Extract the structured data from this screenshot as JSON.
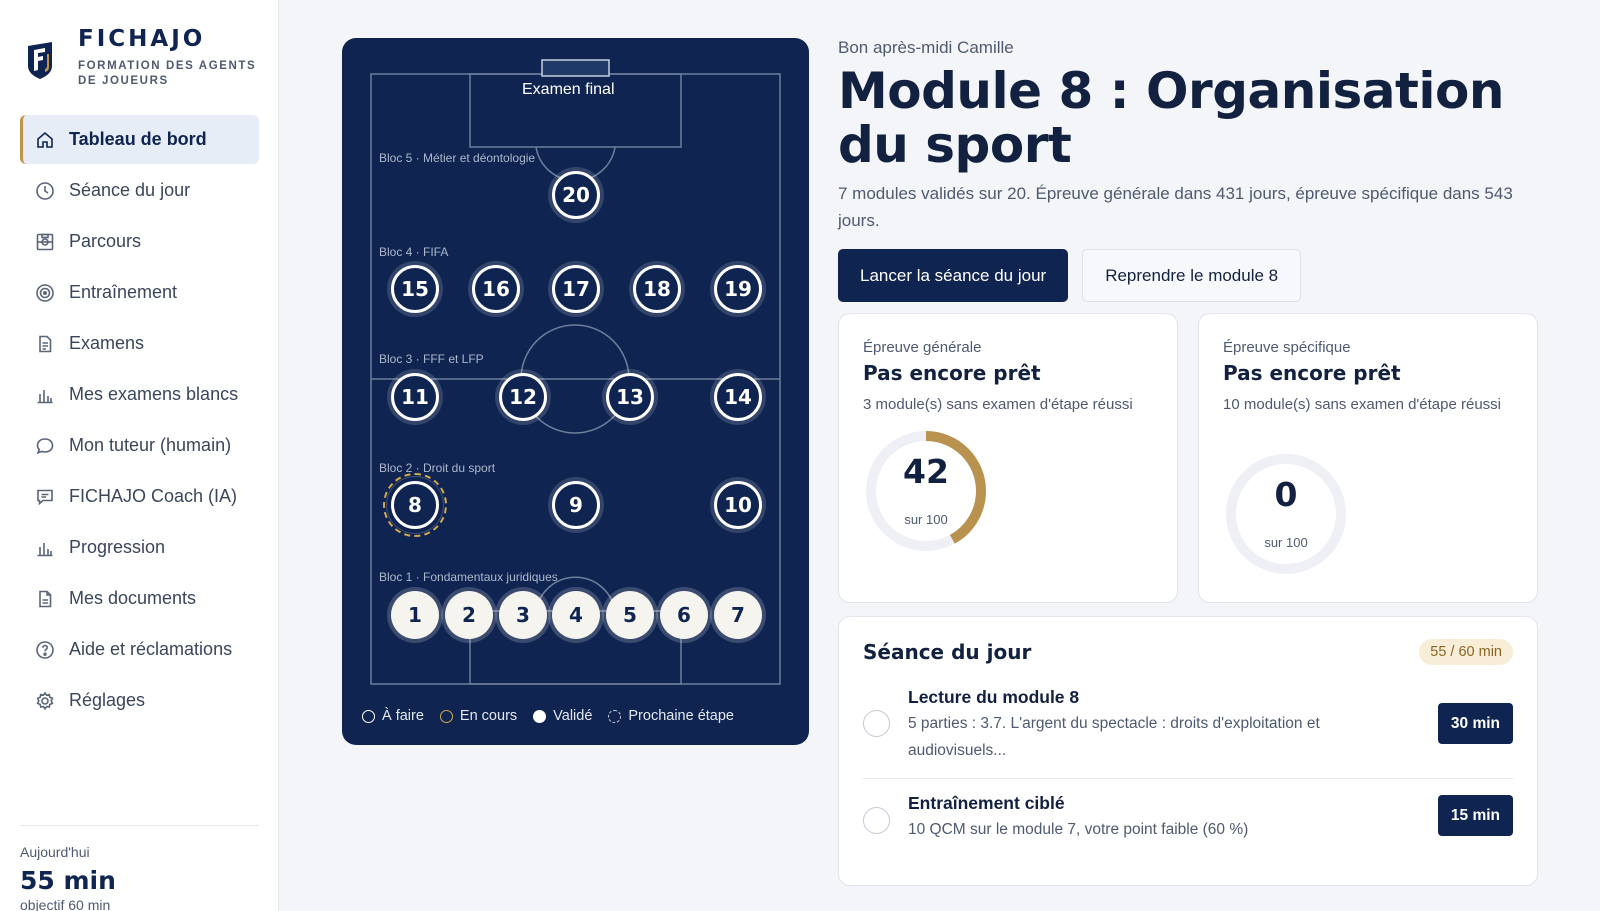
{
  "brand": {
    "name": "FICHAJO",
    "tagline": "FORMATION DES AGENTS DE JOUEURS"
  },
  "nav": [
    {
      "label": "Tableau de bord",
      "icon": "home-icon",
      "active": true
    },
    {
      "label": "Séance du jour",
      "icon": "clock-icon"
    },
    {
      "label": "Parcours",
      "icon": "pitch-icon"
    },
    {
      "label": "Entraînement",
      "icon": "target-icon"
    },
    {
      "label": "Examens",
      "icon": "document-icon"
    },
    {
      "label": "Mes examens blancs",
      "icon": "bar-chart-icon"
    },
    {
      "label": "Mon tuteur (humain)",
      "icon": "chat-bubble-icon"
    },
    {
      "label": "FICHAJO Coach (IA)",
      "icon": "message-square-icon"
    },
    {
      "label": "Progression",
      "icon": "bar-chart-icon"
    },
    {
      "label": "Mes documents",
      "icon": "file-icon"
    },
    {
      "label": "Aide et réclamations",
      "icon": "help-circle-icon"
    },
    {
      "label": "Réglages",
      "icon": "gear-icon"
    }
  ],
  "sidebar_footer": {
    "label": "Aujourd'hui",
    "value": "55 min",
    "goal": "objectif 60 min"
  },
  "pitch": {
    "final_label": "Examen final",
    "blocs": [
      "Bloc 5 · Métier et déontologie",
      "Bloc 4 · FIFA",
      "Bloc 3 · FFF et LFP",
      "Bloc 2 · Droit du sport",
      "Bloc 1 · Fondamentaux juridiques"
    ],
    "modules": [
      {
        "n": "1",
        "state": "done"
      },
      {
        "n": "2",
        "state": "done"
      },
      {
        "n": "3",
        "state": "done"
      },
      {
        "n": "4",
        "state": "done"
      },
      {
        "n": "5",
        "state": "done"
      },
      {
        "n": "6",
        "state": "done"
      },
      {
        "n": "7",
        "state": "done"
      },
      {
        "n": "8",
        "state": "next"
      },
      {
        "n": "9",
        "state": "todo"
      },
      {
        "n": "10",
        "state": "todo"
      },
      {
        "n": "11",
        "state": "todo"
      },
      {
        "n": "12",
        "state": "todo"
      },
      {
        "n": "13",
        "state": "todo"
      },
      {
        "n": "14",
        "state": "todo"
      },
      {
        "n": "15",
        "state": "todo"
      },
      {
        "n": "16",
        "state": "todo"
      },
      {
        "n": "17",
        "state": "todo"
      },
      {
        "n": "18",
        "state": "todo"
      },
      {
        "n": "19",
        "state": "todo"
      },
      {
        "n": "20",
        "state": "todo"
      }
    ],
    "legend": [
      "À faire",
      "En cours",
      "Validé",
      "Prochaine étape"
    ],
    "colors": {
      "pitch": "#0f2450",
      "accent": "#d2a94f"
    }
  },
  "main": {
    "greeting": "Bon après-midi Camille",
    "title": "Module 8 : Organisation du sport",
    "description": "7 modules validés sur 20. Épreuve générale dans 431 jours, épreuve spécifique dans 543 jours.",
    "primary_button": "Lancer la séance du jour",
    "secondary_button": "Reprendre le module 8"
  },
  "exams": [
    {
      "label": "Épreuve générale",
      "status": "Pas encore prêt",
      "sub": "3 module(s) sans examen d'étape réussi",
      "score": "42",
      "score_of": "sur 100",
      "fraction": 0.42
    },
    {
      "label": "Épreuve spécifique",
      "status": "Pas encore prêt",
      "sub": "10 module(s) sans examen d'étape réussi",
      "score": "0",
      "score_of": "sur 100",
      "fraction": 0
    }
  ],
  "session": {
    "title": "Séance du jour",
    "badge": "55 / 60 min",
    "tasks": [
      {
        "title": "Lecture du module 8",
        "desc": "5 parties : 3.7. L'argent du spectacle : droits d'exploitation et audiovisuels...",
        "duration": "30 min"
      },
      {
        "title": "Entraînement ciblé",
        "desc": "10 QCM sur le module 7, votre point faible (60 %)",
        "duration": "15 min"
      }
    ]
  }
}
